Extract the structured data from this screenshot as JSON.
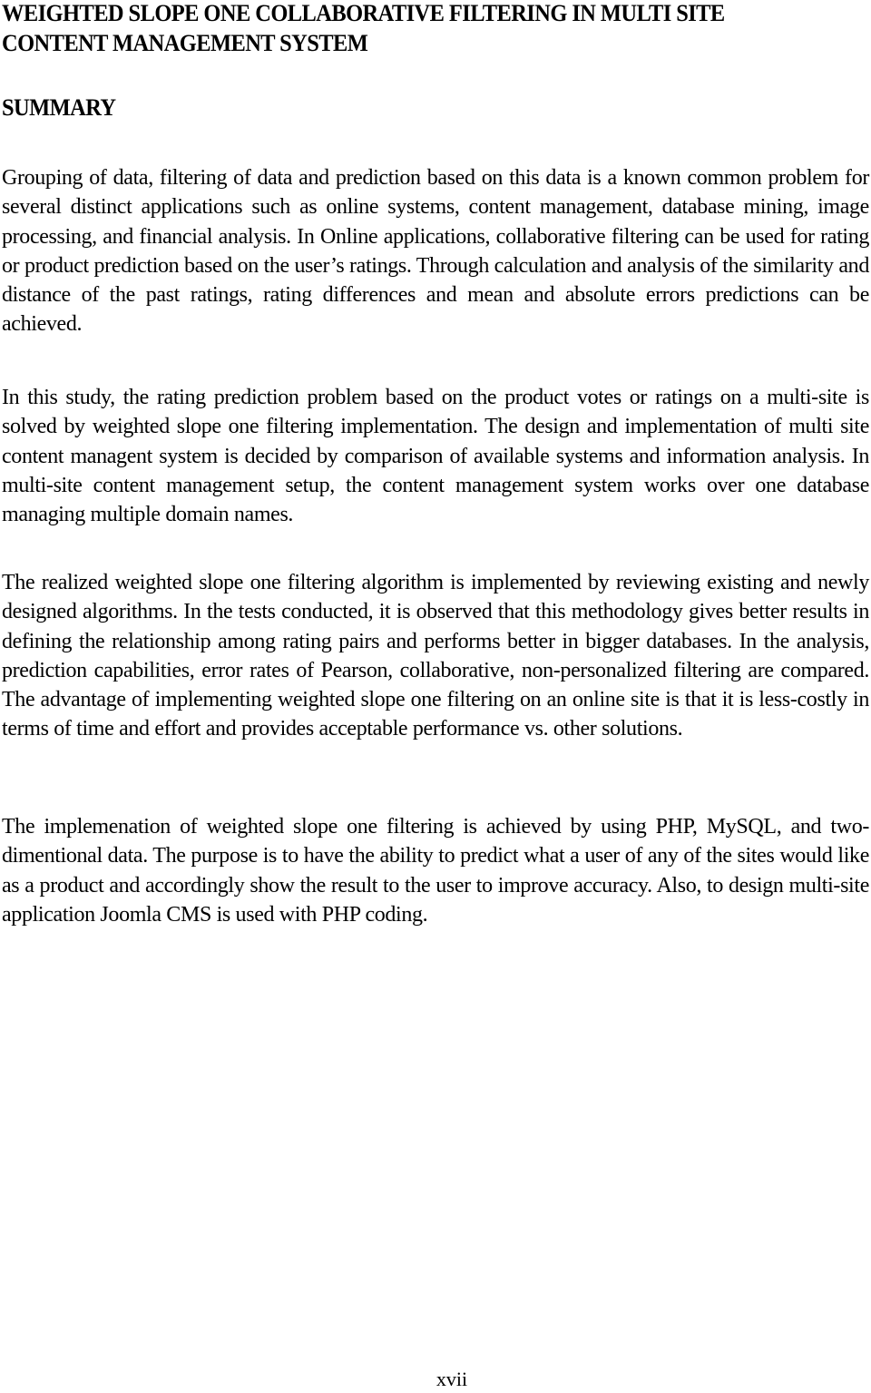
{
  "document": {
    "title_lines": [
      "WEIGHTED SLOPE ONE COLLABORATIVE FILTERING IN MULTI SITE",
      "CONTENT MANAGEMENT SYSTEM"
    ],
    "section_heading": "SUMMARY",
    "paragraphs": [
      "Grouping of data, filtering of data and prediction based on this data is a known common problem for several distinct applications such as online systems, content management, database mining, image processing, and financial analysis. In Online applications, collaborative filtering can be used for rating or product prediction based on the user’s ratings. Through calculation and analysis of the similarity and distance of the past ratings, rating differences and mean and absolute errors predictions can be achieved.",
      "In this study, the rating prediction problem based on the product votes or ratings on a multi-site is solved by weighted slope one filtering implementation. The design and implementation of multi site content managent system is decided by comparison of available systems and information analysis. In multi-site content management setup, the content management system works over one database managing multiple domain names.",
      "The realized weighted slope one filtering algorithm is implemented by reviewing existing and newly designed algorithms. In the tests conducted, it is observed that this methodology gives better results in defining the relationship among rating pairs and performs better in bigger databases. In the analysis, prediction capabilities, error rates of Pearson, collaborative, non-personalized filtering are compared. The advantage of implementing weighted slope one filtering on an online site is that it is less-costly in terms of time and effort and provides acceptable performance vs. other solutions.",
      "The implemenation of weighted slope one filtering is achieved by using PHP, MySQL, and two-dimentional data. The purpose is to have the ability to predict what a user of any of the sites would like as a product and accordingly show the result to the user to improve accuracy. Also, to design multi-site application Joomla CMS is used with PHP coding."
    ],
    "page_number": "xvii"
  }
}
